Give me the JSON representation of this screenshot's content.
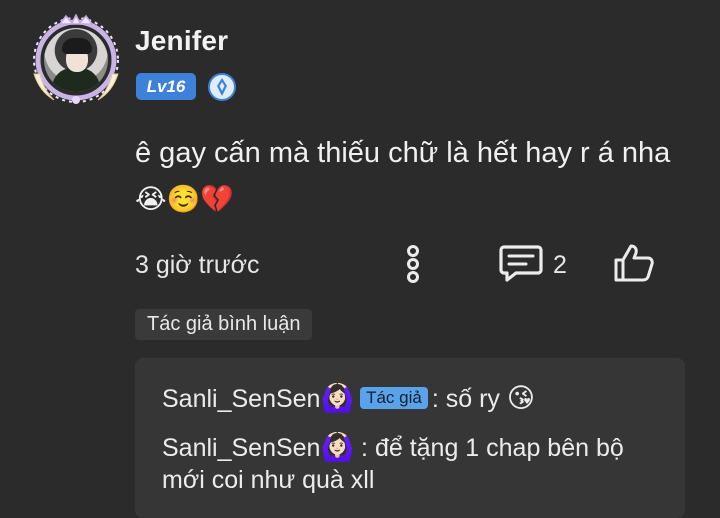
{
  "comment": {
    "username": "Jenifer",
    "level": "Lv16",
    "text": "ê gay cấn mà thiếu chữ là hết hay r á nha",
    "emojis": "😭☺️💔",
    "time": "3 giờ trước",
    "reply_count": "2",
    "author_tag": "Tác giả bình luận",
    "icons": {
      "more": "more-vertical-icon",
      "reply": "message-icon",
      "like": "thumbs-up-icon",
      "rank": "rank-badge-icon"
    }
  },
  "replies": [
    {
      "name": "Sanli_SenSen",
      "name_emoji": "🙆🏻‍♀️",
      "badge": "Tác giả",
      "text": ": số ry",
      "emoji": "😘"
    },
    {
      "name": "Sanli_SenSen",
      "name_emoji": "🙆🏻‍♀️",
      "text": ": để tặng 1 chap bên bộ mới coi như quà xll"
    }
  ],
  "colors": {
    "background": "#2b2b2c",
    "level_badge": "#3d82d8",
    "author_badge": "#5aa2ea",
    "reply_box": "#363637"
  }
}
